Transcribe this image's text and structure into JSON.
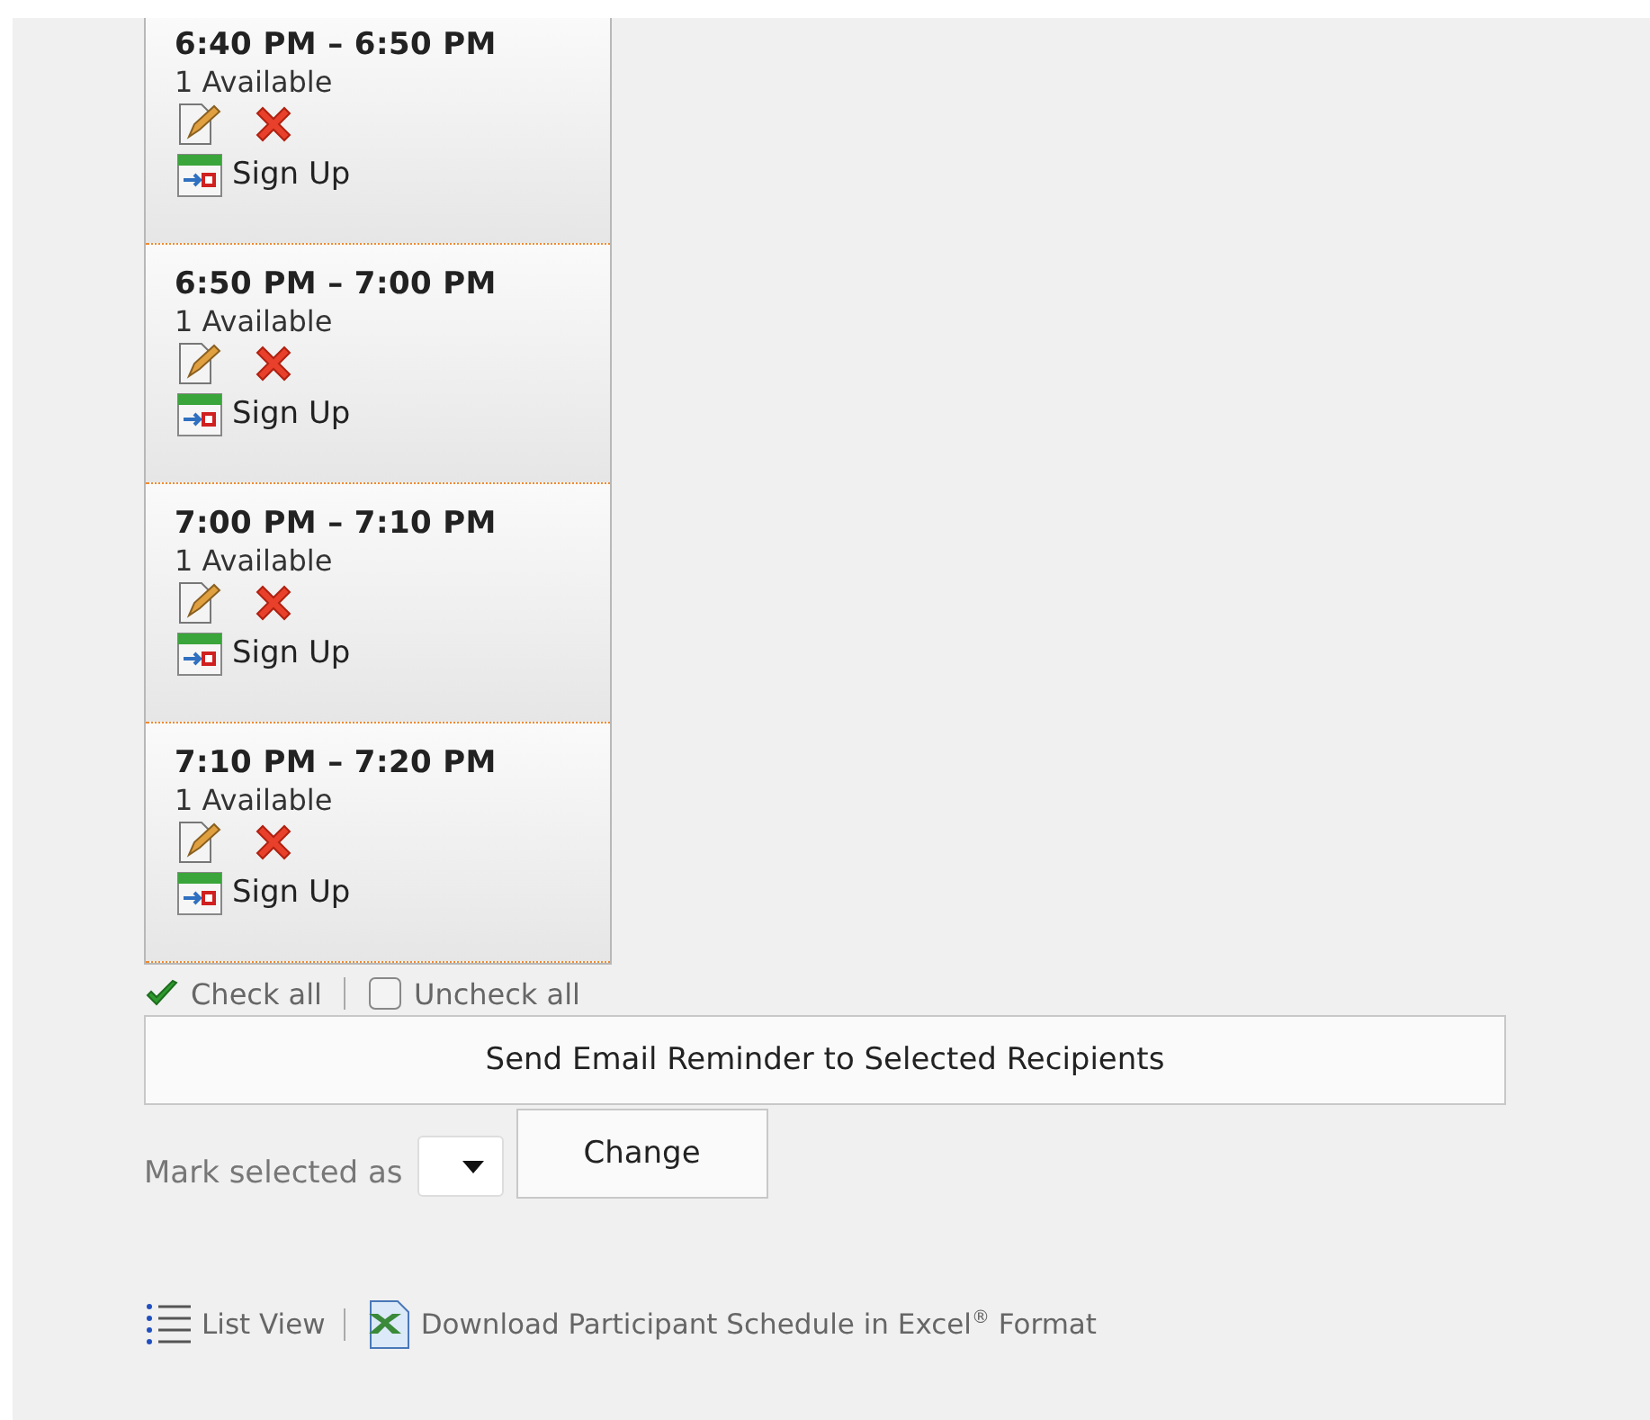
{
  "slots": [
    {
      "time": "6:40 PM – 6:50 PM",
      "availability": "1 Available",
      "action": "Sign Up"
    },
    {
      "time": "6:50 PM – 7:00 PM",
      "availability": "1 Available",
      "action": "Sign Up"
    },
    {
      "time": "7:00 PM – 7:10 PM",
      "availability": "1 Available",
      "action": "Sign Up"
    },
    {
      "time": "7:10 PM – 7:20 PM",
      "availability": "1 Available",
      "action": "Sign Up"
    }
  ],
  "check_all": "Check all",
  "uncheck_all": "Uncheck all",
  "send_button": "Send Email Reminder to Selected Recipients",
  "mark_label": "Mark selected as",
  "change_button": "Change",
  "list_view": "List View",
  "download": "Download Participant Schedule in Excel$^{®}$ Format"
}
